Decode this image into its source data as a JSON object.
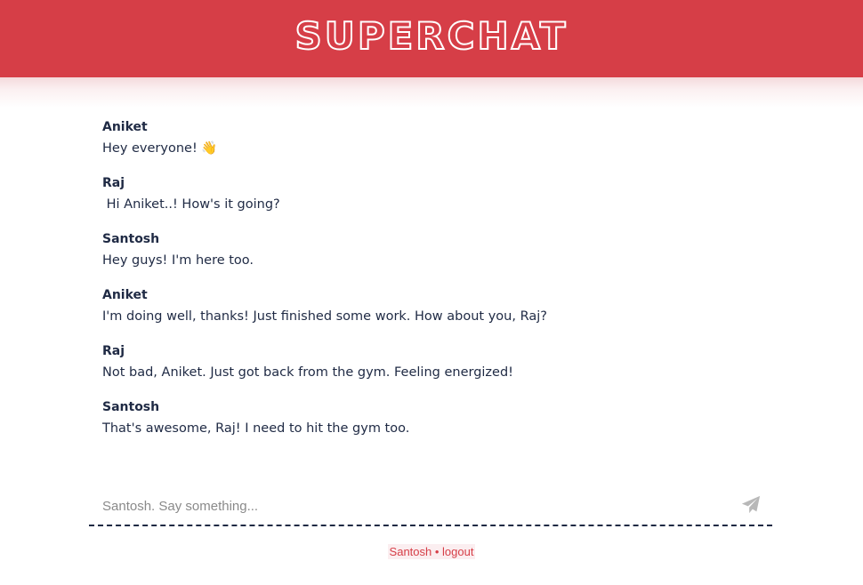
{
  "header": {
    "title": "SUPERCHAT"
  },
  "messages": [
    {
      "author": "Aniket",
      "text": "Hey everyone! 👋"
    },
    {
      "author": "Raj",
      "text": " Hi Aniket..! How's it going?"
    },
    {
      "author": "Santosh",
      "text": "Hey guys! I'm here too."
    },
    {
      "author": "Aniket",
      "text": "I'm doing well, thanks! Just finished some work. How about you, Raj?"
    },
    {
      "author": "Raj",
      "text": "Not bad, Aniket. Just got back from the gym. Feeling energized!"
    },
    {
      "author": "Santosh",
      "text": "That's awesome, Raj! I need to hit the gym too."
    }
  ],
  "composer": {
    "placeholder": "Santosh. Say something...",
    "value": "",
    "send_icon": "send-icon"
  },
  "footer": {
    "username": "Santosh",
    "separator": " • ",
    "logout_label": "logout"
  },
  "colors": {
    "brand": "#d63e47",
    "text": "#1f2a44"
  }
}
